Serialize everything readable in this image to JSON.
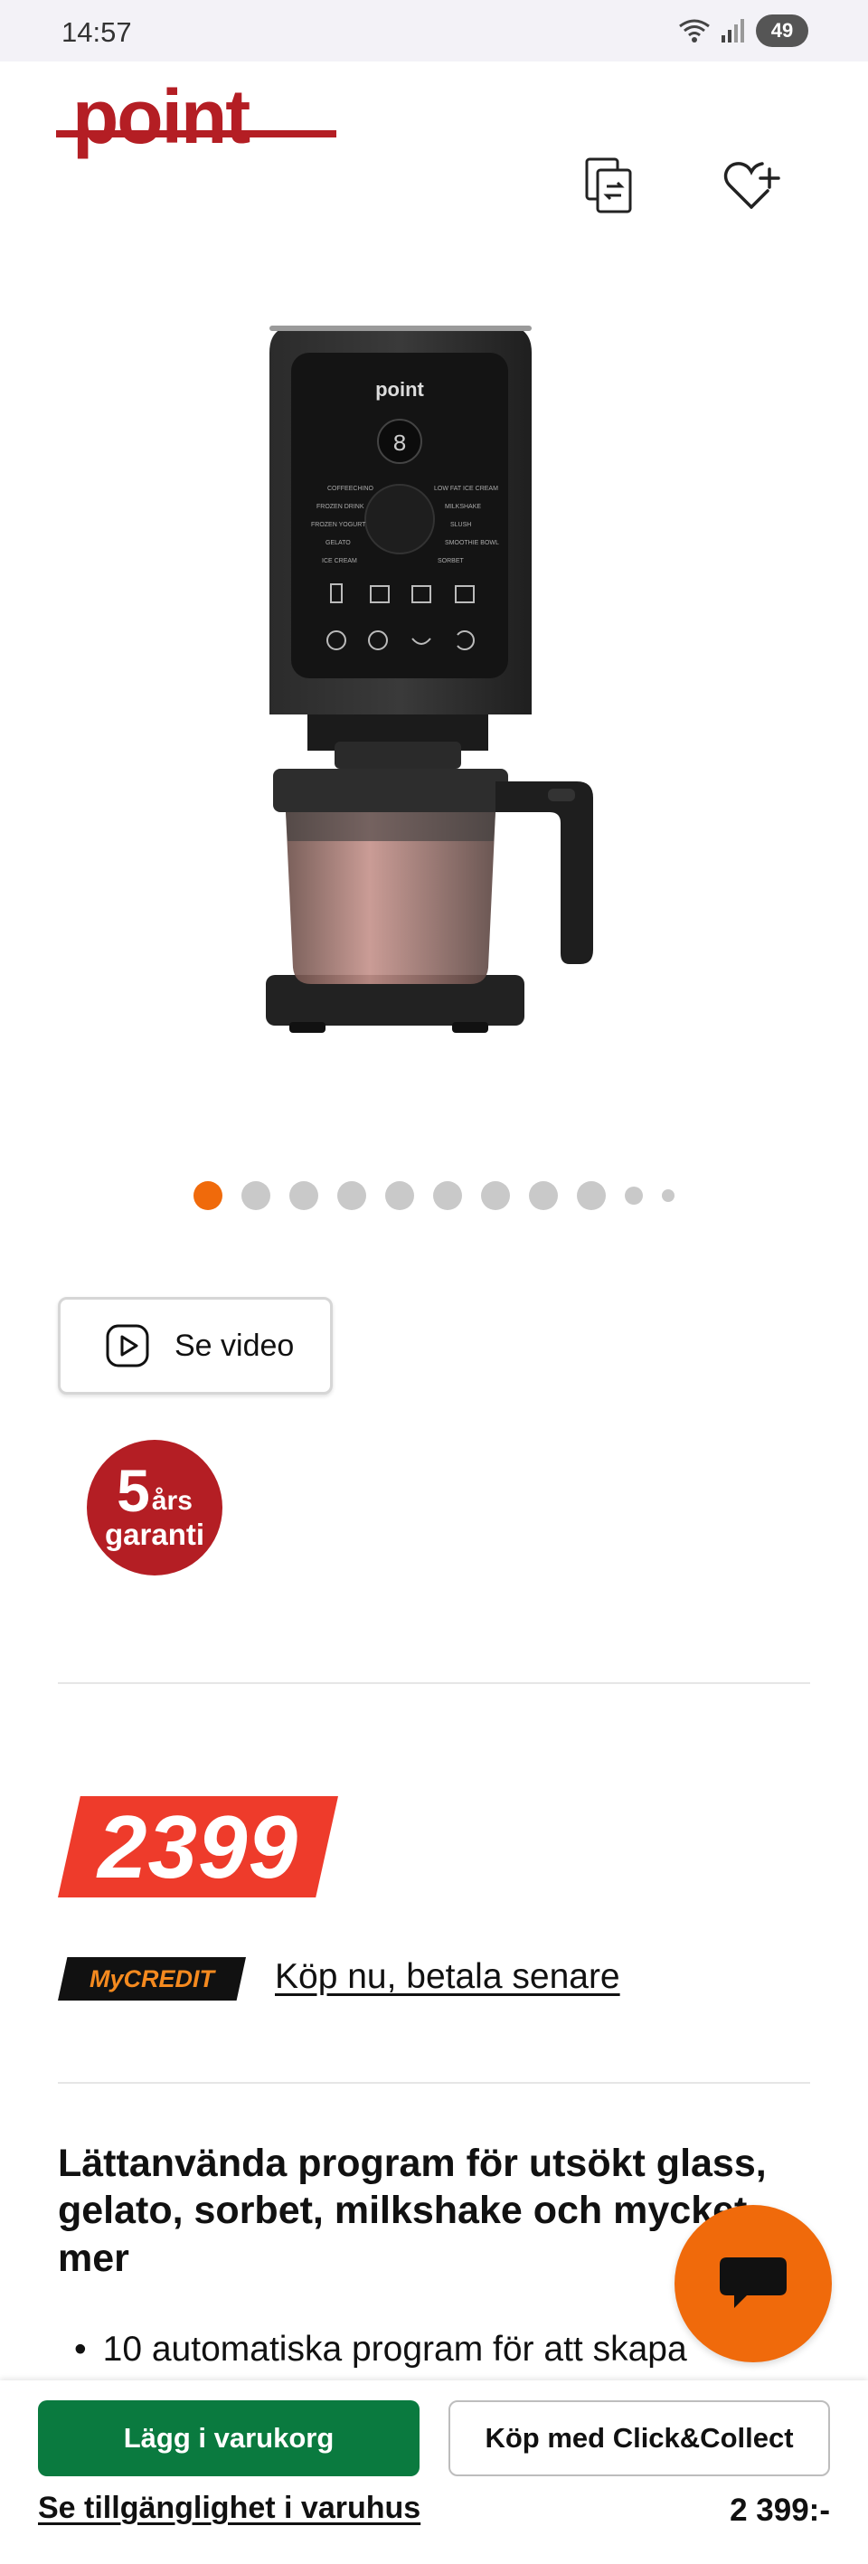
{
  "status_bar": {
    "time": "14:57",
    "battery": "49"
  },
  "header": {
    "logo_text": "point",
    "compare_icon": "compare-icon",
    "wishlist_icon": "heart-plus-icon"
  },
  "gallery": {
    "total_dots": 11,
    "active_index": 0
  },
  "video": {
    "label": "Se video"
  },
  "warranty": {
    "years": "5",
    "years_suffix": "års",
    "label": "garanti"
  },
  "price": {
    "value": "2399"
  },
  "credit": {
    "badge": "MyCREDIT",
    "link": "Köp nu, betala senare"
  },
  "description": {
    "heading": "Lättanvända program för utsökt glass, gelato, sorbet, milkshake och mycket mer",
    "bullets": [
      "10 automatiska program för att skapa"
    ]
  },
  "bottom_bar": {
    "add_to_cart": "Lägg i varukorg",
    "click_collect": "Köp med Click&Collect",
    "availability_link": "Se tillgänglighet i varuhus",
    "price": "2 399:-"
  },
  "colors": {
    "accent_orange": "#f06a0b",
    "brand_red": "#b41e24",
    "price_red": "#ee3b2b",
    "cart_green": "#0a7a3f"
  }
}
